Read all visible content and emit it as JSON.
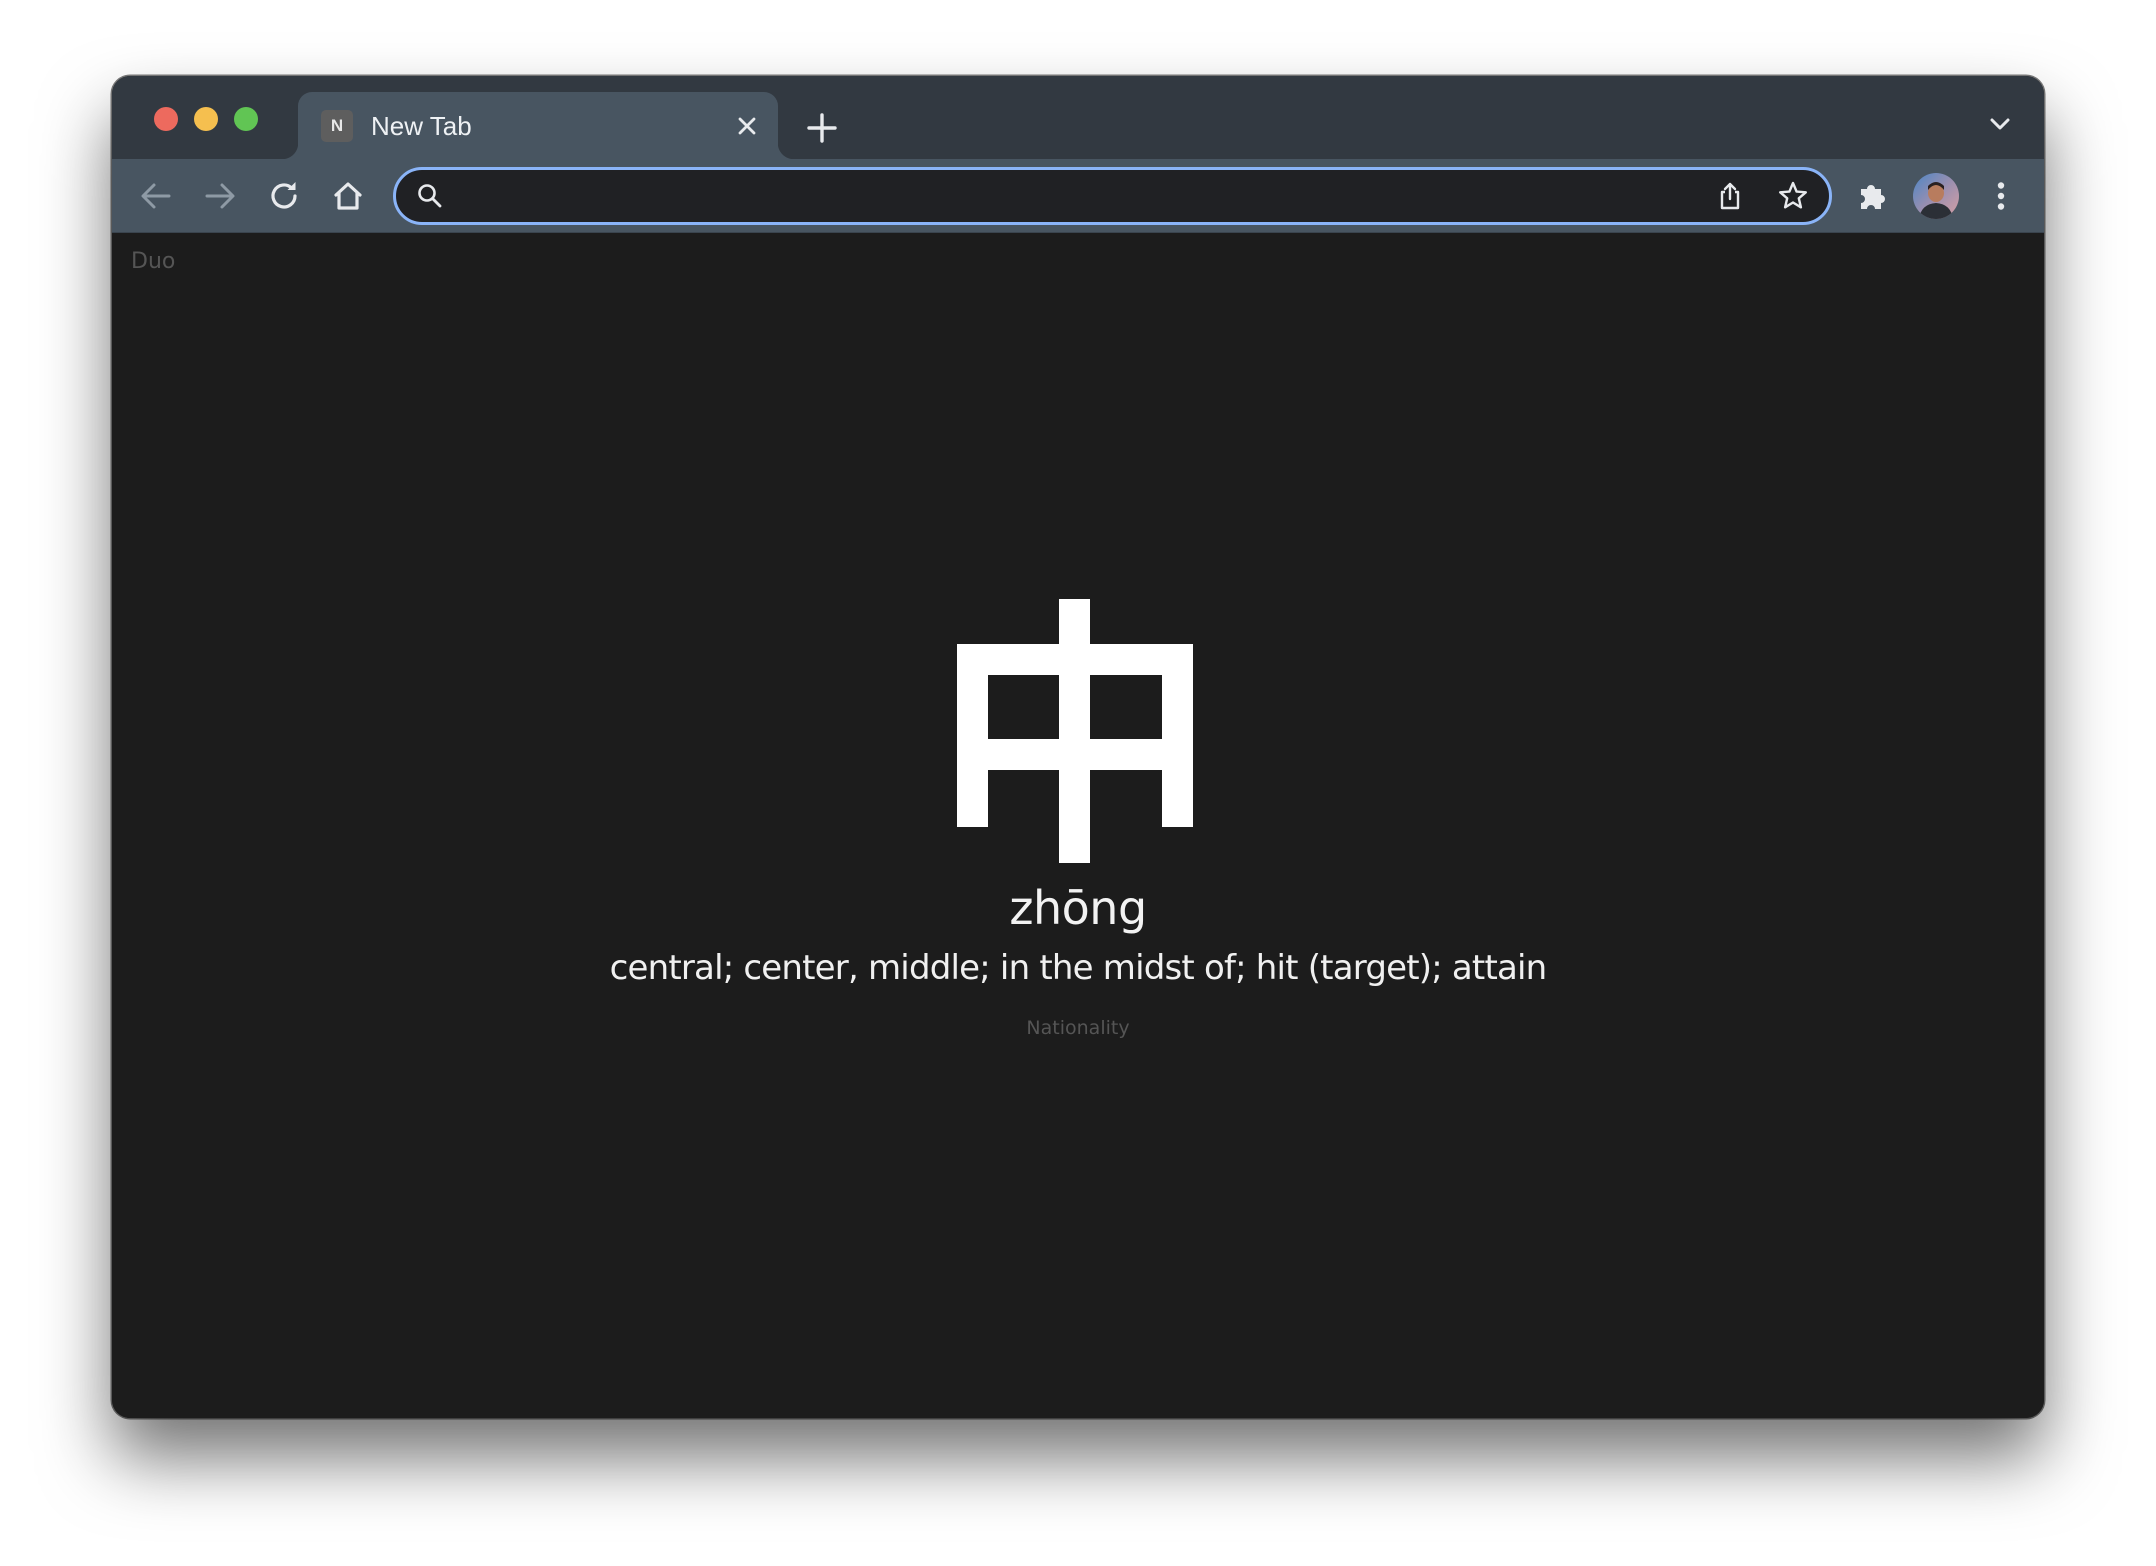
{
  "tabs": [
    {
      "favicon_letter": "N",
      "title": "New Tab"
    }
  ],
  "omnibox": {
    "value": "",
    "placeholder": ""
  },
  "page": {
    "brand": "Duo",
    "character": "中",
    "pinyin": "zhōng",
    "meaning": "central; center, middle; in the midst of; hit (target); attain",
    "category": "Nationality"
  },
  "colors": {
    "tabstrip_bg": "#323941",
    "toolbar_bg": "#485561",
    "omnibox_border": "#8ab4f8",
    "page_bg": "#1c1c1c",
    "text_primary": "#f2f2f2",
    "text_muted": "#555555"
  },
  "icons": {
    "window_controls": [
      "close-dot",
      "minimize-dot",
      "zoom-dot"
    ],
    "tab": [
      "favicon",
      "close-icon"
    ],
    "tabstrip": [
      "plus-icon",
      "chevron-down-icon"
    ],
    "toolbar": [
      "arrow-left-icon",
      "arrow-right-icon",
      "reload-icon",
      "home-icon",
      "search-icon",
      "share-icon",
      "star-icon",
      "puzzle-icon",
      "avatar",
      "kebab-menu-icon"
    ]
  }
}
